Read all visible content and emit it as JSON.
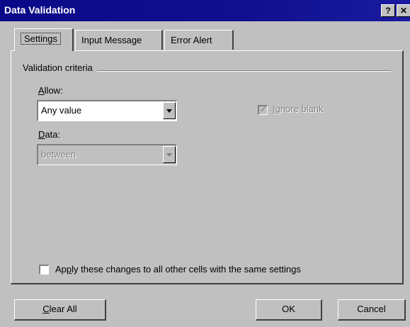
{
  "window": {
    "title": "Data Validation",
    "help_glyph": "?",
    "close_glyph": "✕"
  },
  "tabs": [
    {
      "label": "Settings",
      "active": true
    },
    {
      "label": "Input Message",
      "active": false
    },
    {
      "label": "Error Alert",
      "active": false
    }
  ],
  "criteria": {
    "group_title": "Validation criteria",
    "allow_label_accel": "A",
    "allow_label_rest": "llow:",
    "allow_value": "Any value",
    "data_label_accel": "D",
    "data_label_rest": "ata:",
    "data_value": "between",
    "ignore_blank_accel": "I",
    "ignore_blank_rest": "gnore blank",
    "ignore_blank_checked": true
  },
  "apply": {
    "label_pre": "Ap",
    "label_accel": "p",
    "label_post": "ly these changes to all other cells with the same settings",
    "checked": false
  },
  "buttons": {
    "clear_accel": "C",
    "clear_rest": "lear All",
    "ok": "OK",
    "cancel": "Cancel"
  }
}
